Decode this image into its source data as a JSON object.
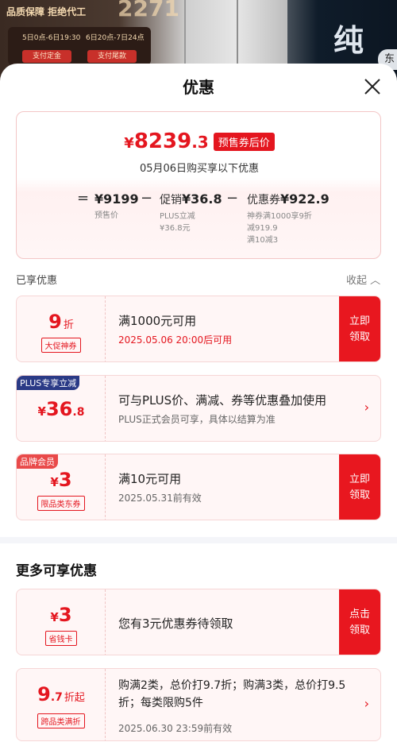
{
  "banner": {
    "tag": "品质保障 拒绝代工",
    "number_fragment": "2271",
    "date1": "5日0点-6日19:30",
    "date2": "6日20点-7日24点",
    "btn1": "支付定金",
    "btn2": "支付尾款",
    "char": "纯",
    "side": "东"
  },
  "sheet": {
    "title": "优惠"
  },
  "summary": {
    "price_currency": "¥",
    "price_int": "8239",
    "price_dec": ".3",
    "price_tag": "预售券后价",
    "date_line": "05月06日购买享以下优惠",
    "eq": "=",
    "minus1": "−",
    "minus2": "−",
    "presale_value": "¥9199",
    "presale_label": "预售价",
    "promo_prefix": "促销",
    "promo_value": "¥36.8",
    "promo_sub1": "PLUS立减",
    "promo_sub2": "¥36.8元",
    "coupon_prefix": "优惠券",
    "coupon_value": "¥922.9",
    "coupon_sub1": "神券满1000享9折",
    "coupon_sub2": "减919.9",
    "coupon_sub3": "满10减3"
  },
  "enjoyed": {
    "title": "已享优惠",
    "collapse_label": "收起"
  },
  "coupons": [
    {
      "value": "9",
      "unit": "折",
      "sub": "大促神券",
      "title": "满1000元可用",
      "desc": "2025.05.06 20:00后可用",
      "action": "立即\n领取"
    },
    {
      "badge": "PLUS专享立减",
      "currency": "¥",
      "value": "36",
      "dec": ".8",
      "title": "可与PLUS价、满减、券等优惠叠加使用",
      "desc": "PLUS正式会员可享，具体以结算为准"
    },
    {
      "badge": "品牌会员",
      "currency": "¥",
      "value": "3",
      "sub": "限品类东券",
      "title": "满10元可用",
      "desc": "2025.05.31前有效",
      "action": "立即\n领取"
    }
  ],
  "more": {
    "title": "更多可享优惠",
    "items": [
      {
        "currency": "¥",
        "value": "3",
        "sub": "省钱卡",
        "title": "您有3元优惠券待领取",
        "action": "点击\n领取"
      },
      {
        "value": "9",
        "dec": ".7",
        "unit": "折起",
        "sub": "跨品类满折",
        "title": "购满2类，总价打9.7折；购满3类，总价打9.5折；每类限购5件",
        "desc": "2025.06.30 23:59前有效"
      }
    ]
  },
  "colors": {
    "accent": "#e4161f",
    "plus_badge": "#2a3a86"
  }
}
